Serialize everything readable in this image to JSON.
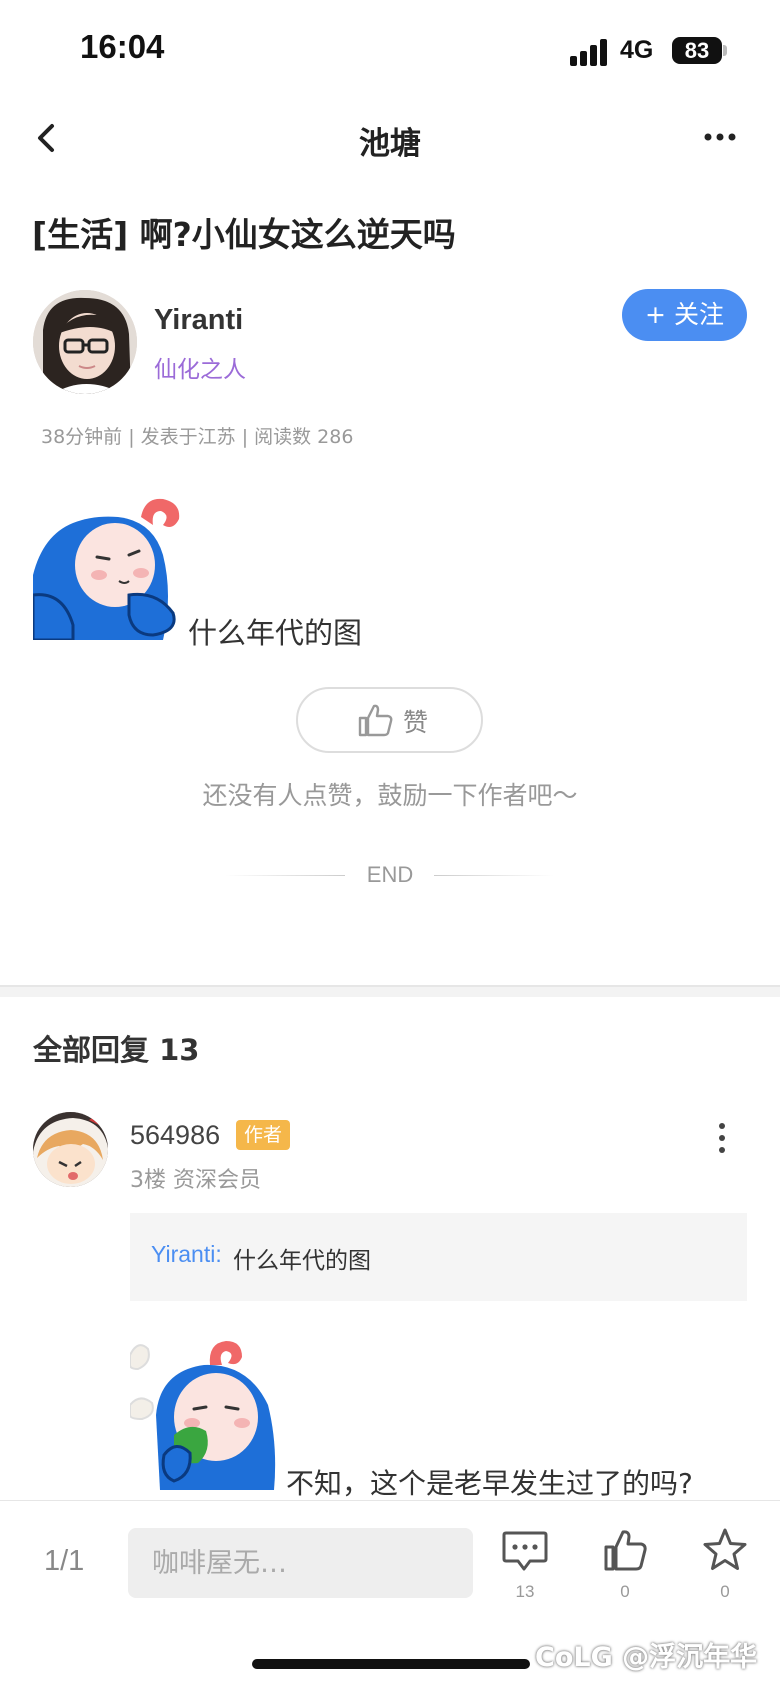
{
  "status_bar": {
    "time": "16:04",
    "network": "4G",
    "battery": "83"
  },
  "nav": {
    "title": "池塘"
  },
  "post": {
    "title": "[生活] 啊?小仙女这么逆天吗",
    "author": {
      "name": "Yiranti",
      "title": "仙化之人"
    },
    "follow_label": "+ 关注",
    "meta": "38分钟前 | 发表于江苏 | 阅读数 286",
    "text": "什么年代的图",
    "like_label": "赞",
    "encourage": "还没有人点赞，鼓励一下作者吧～",
    "end": "END"
  },
  "replies": {
    "heading": "全部回复  13",
    "items": [
      {
        "user": "564986",
        "badge": "作者",
        "meta": "3楼 资深会员",
        "quote_name": "Yiranti:",
        "quote_text": "什么年代的图",
        "text": "不知，这个是老早发生过了的吗?"
      }
    ]
  },
  "bottom_bar": {
    "page": "1/1",
    "input_placeholder": "咖啡屋无…",
    "comment_count": "13",
    "like_count": "0",
    "star_count": "0"
  },
  "watermark": "CoLG @浮沉年华",
  "colors": {
    "accent": "#4b8ef2",
    "title_purple": "#9b6bd8",
    "badge": "#f5b74a"
  },
  "icons": [
    "back-icon",
    "more-icon",
    "thumbs-up-icon",
    "comment-icon",
    "star-icon",
    "signal-icon",
    "battery-icon"
  ]
}
